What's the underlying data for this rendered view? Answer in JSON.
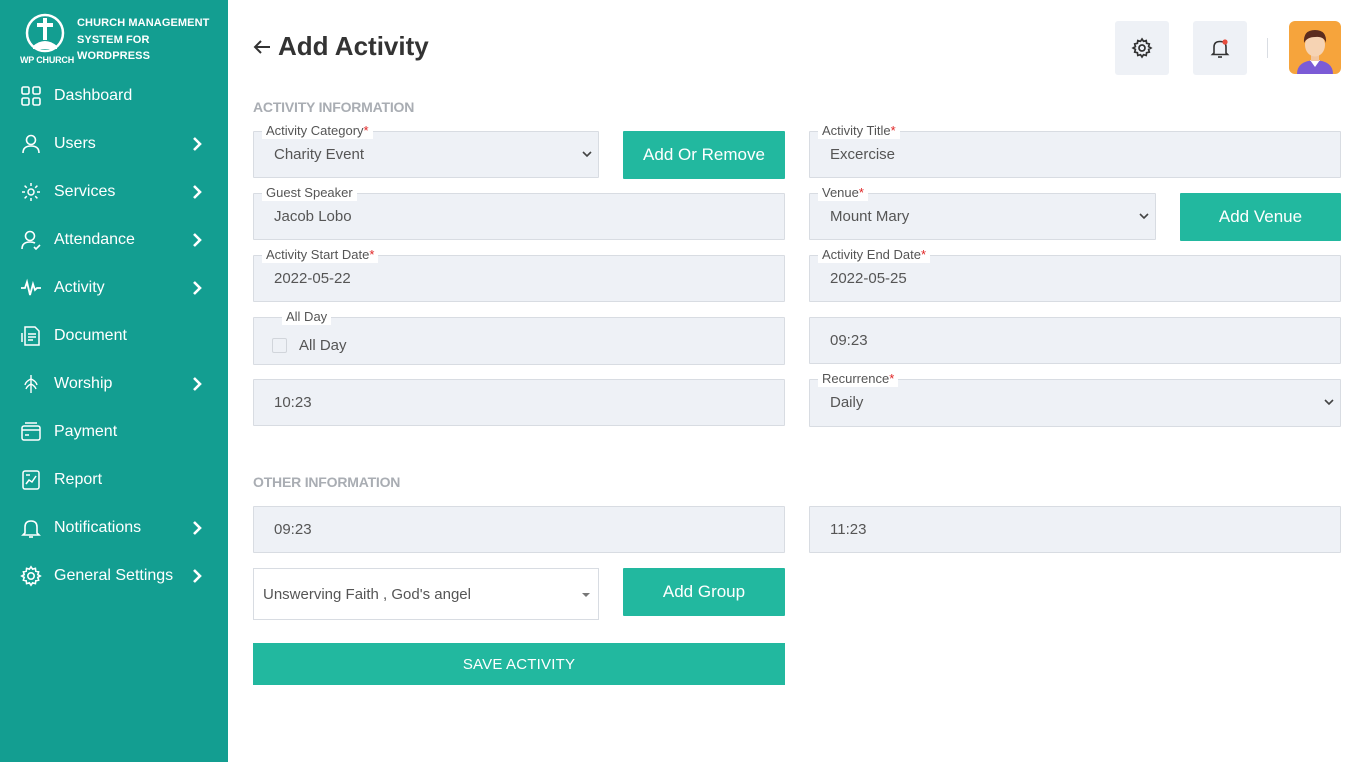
{
  "brand": {
    "line1": "CHURCH MANAGEMENT",
    "line2": "SYSTEM FOR",
    "line3": "WORDPRESS",
    "logo_text": "WP CHURCH"
  },
  "sidebar": {
    "items": [
      {
        "label": "Dashboard",
        "icon": "grid-icon",
        "has_submenu": false
      },
      {
        "label": "Users",
        "icon": "user-icon",
        "has_submenu": true
      },
      {
        "label": "Services",
        "icon": "services-icon",
        "has_submenu": true
      },
      {
        "label": "Attendance",
        "icon": "attendance-icon",
        "has_submenu": true
      },
      {
        "label": "Activity",
        "icon": "pulse-icon",
        "has_submenu": true
      },
      {
        "label": "Document",
        "icon": "document-icon",
        "has_submenu": false
      },
      {
        "label": "Worship",
        "icon": "worship-icon",
        "has_submenu": true
      },
      {
        "label": "Payment",
        "icon": "payment-icon",
        "has_submenu": false
      },
      {
        "label": "Report",
        "icon": "report-icon",
        "has_submenu": false
      },
      {
        "label": "Notifications",
        "icon": "bell-icon",
        "has_submenu": true
      },
      {
        "label": "General Settings",
        "icon": "gear-icon",
        "has_submenu": true
      }
    ]
  },
  "header": {
    "title": "Add Activity"
  },
  "sections": {
    "activity_info": "ACTIVITY INFORMATION",
    "other_info": "OTHER INFORMATION"
  },
  "form": {
    "activity_category": {
      "label": "Activity Category",
      "value": "Charity Event",
      "required": "*"
    },
    "add_or_remove": "Add Or Remove",
    "activity_title": {
      "label": "Activity Title",
      "value": "Excercise",
      "required": "*"
    },
    "guest_speaker": {
      "label": "Guest Speaker",
      "value": "Jacob Lobo"
    },
    "venue": {
      "label": "Venue",
      "value": "Mount Mary",
      "required": "*"
    },
    "add_venue": "Add Venue",
    "start_date": {
      "label": "Activity Start Date",
      "value": "2022-05-22",
      "required": "*"
    },
    "end_date": {
      "label": "Activity End Date",
      "value": "2022-05-25",
      "required": "*"
    },
    "all_day": {
      "label": "All Day",
      "checkbox_label": "All Day",
      "checked": false
    },
    "start_time": "09:23",
    "end_time": "10:23",
    "recurrence": {
      "label": "Recurrence",
      "value": "Daily",
      "required": "*"
    },
    "other_time_1": "09:23",
    "other_time_2": "11:23",
    "groups": "Unswerving Faith , God's angel",
    "add_group": "Add Group",
    "save": "SAVE ACTIVITY"
  },
  "colors": {
    "sidebar_bg": "#139e91",
    "accent": "#22b89f",
    "field_bg": "#eef1f6",
    "required": "#e02424",
    "notification_dot": "#e84c3d",
    "avatar_bg": "#f6a43c"
  }
}
